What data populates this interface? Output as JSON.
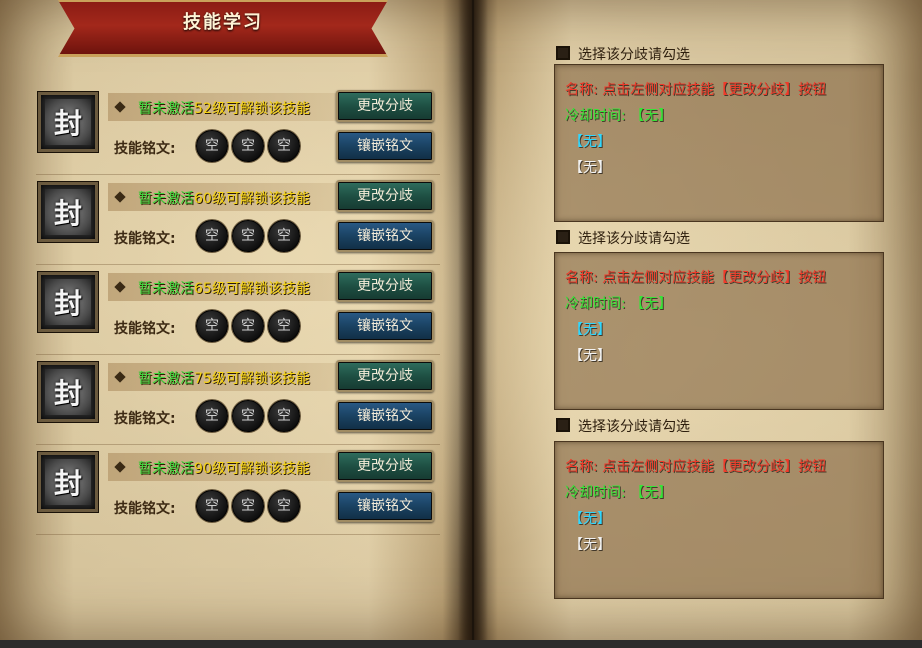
{
  "header": {
    "title": "技能学习"
  },
  "skills": [
    {
      "icon_glyph": "封",
      "prefix": "暂未激活",
      "unlock": "52级可解锁该技能",
      "rune_label": "技能铭文:",
      "slots": [
        "空",
        "空",
        "空"
      ],
      "btn_branch": "更改分歧",
      "btn_inlay": "镶嵌铭文"
    },
    {
      "icon_glyph": "封",
      "prefix": "暂未激活",
      "unlock": "60级可解锁该技能",
      "rune_label": "技能铭文:",
      "slots": [
        "空",
        "空",
        "空"
      ],
      "btn_branch": "更改分歧",
      "btn_inlay": "镶嵌铭文"
    },
    {
      "icon_glyph": "封",
      "prefix": "暂未激活",
      "unlock": "65级可解锁该技能",
      "rune_label": "技能铭文:",
      "slots": [
        "空",
        "空",
        "空"
      ],
      "btn_branch": "更改分歧",
      "btn_inlay": "镶嵌铭文"
    },
    {
      "icon_glyph": "封",
      "prefix": "暂未激活",
      "unlock": "75级可解锁该技能",
      "rune_label": "技能铭文:",
      "slots": [
        "空",
        "空",
        "空"
      ],
      "btn_branch": "更改分歧",
      "btn_inlay": "镶嵌铭文"
    },
    {
      "icon_glyph": "封",
      "prefix": "暂未激活",
      "unlock": "90级可解锁该技能",
      "rune_label": "技能铭文:",
      "slots": [
        "空",
        "空",
        "空"
      ],
      "btn_branch": "更改分歧",
      "btn_inlay": "镶嵌铭文"
    }
  ],
  "branches": [
    {
      "check_label": "选择该分歧请勾选",
      "name_line": "名称: 点击左侧对应技能【更改分歧】按钮",
      "cooldown_line": "冷却时间: 【无】",
      "line3": "【无】",
      "line4": "【无】"
    },
    {
      "check_label": "选择该分歧请勾选",
      "name_line": "名称: 点击左侧对应技能【更改分歧】按钮",
      "cooldown_line": "冷却时间: 【无】",
      "line3": "【无】",
      "line4": "【无】"
    },
    {
      "check_label": "选择该分歧请勾选",
      "name_line": "名称: 点击左侧对应技能【更改分歧】按钮",
      "cooldown_line": "冷却时间: 【无】",
      "line3": "【无】",
      "line4": "【无】"
    }
  ],
  "colors": {
    "ribbon": "#a3281b",
    "unlock_text": "#f5d312",
    "inactive_text": "#3bd93b",
    "name_text": "#f03a2a",
    "cooldown_text": "#37e437",
    "cyan_text": "#2fd7ff"
  },
  "icons": {
    "skill": "sealed-skill-icon",
    "bullet": "diamond-bullet-icon"
  }
}
